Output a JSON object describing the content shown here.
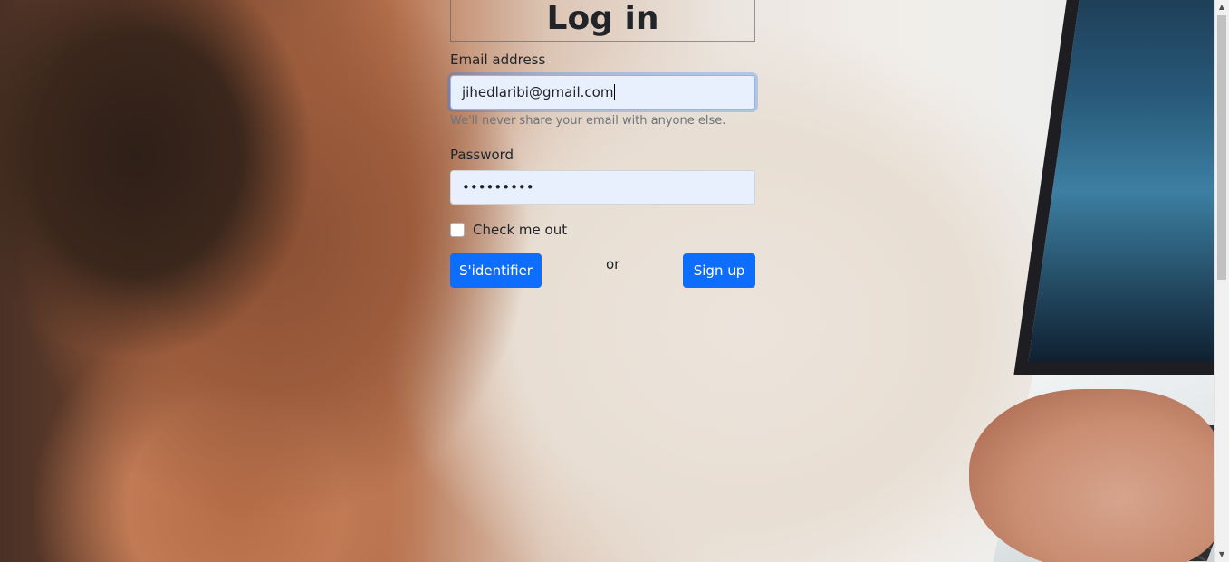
{
  "form": {
    "title": "Log in",
    "email_label": "Email address",
    "email_value": "jihedlaribi@gmail.com",
    "email_help": "We'll never share your email with anyone else.",
    "password_label": "Password",
    "password_value": "•••••••••",
    "checkbox_label": "Check me out",
    "login_button": "S'identifier",
    "or_text": "or",
    "signup_button": "Sign up"
  },
  "scrollbar": {
    "up_arrow": "▲",
    "down_arrow": "▼"
  },
  "colors": {
    "primary": "#0d6efd",
    "input_autofill_bg": "#e8f0fe"
  }
}
